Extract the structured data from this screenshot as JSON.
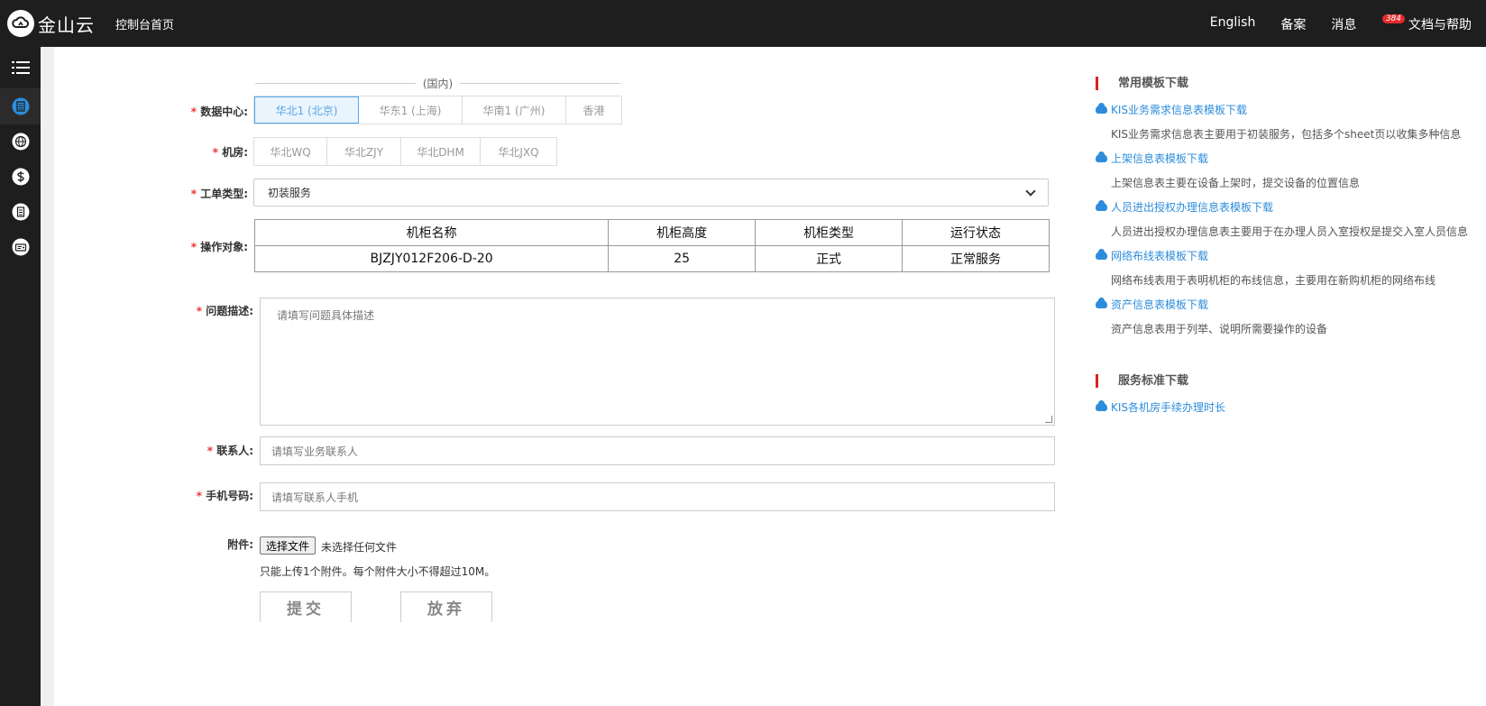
{
  "header": {
    "logo_text": "金山云",
    "console_home": "控制台首页",
    "nav": [
      {
        "label": "English"
      },
      {
        "label": "备案"
      },
      {
        "label": "消息",
        "badge": "384"
      },
      {
        "label": "文档与帮助"
      }
    ]
  },
  "sidebar": {
    "items": [
      "menu-icon",
      "server-list-icon",
      "globe-icon",
      "dollar-icon",
      "document-icon",
      "ticket-icon"
    ],
    "active_index": 1
  },
  "form": {
    "domestic_label": "(国内)",
    "datacenter": {
      "label": "数据中心:",
      "options": [
        "华北1 (北京)",
        "华东1 (上海)",
        "华南1 (广州)",
        "香港"
      ],
      "selected": 0
    },
    "room": {
      "label": "机房:",
      "options": [
        "华北WQ",
        "华北ZJY",
        "华北DHM",
        "华北JXQ"
      ]
    },
    "ticket_type": {
      "label": "工单类型:",
      "value": "初装服务"
    },
    "target": {
      "label": "操作对象:",
      "headers": [
        "机柜名称",
        "机柜高度",
        "机柜类型",
        "运行状态"
      ],
      "rows": [
        [
          "BJZJY012F206-D-20",
          "25",
          "正式",
          "正常服务"
        ]
      ]
    },
    "description": {
      "label": "问题描述:",
      "placeholder": "请填写问题具体描述"
    },
    "contact": {
      "label": "联系人:",
      "placeholder": "请填写业务联系人"
    },
    "phone": {
      "label": "手机号码:",
      "placeholder": "请填写联系人手机"
    },
    "attachment": {
      "label": "附件:",
      "button": "选择文件",
      "status": "未选择任何文件",
      "hint": "只能上传1个附件。每个附件大小不得超过10M。"
    },
    "submit": "提交",
    "cancel": "放弃"
  },
  "templates": {
    "title": "常用模板下载",
    "items": [
      {
        "link": "KIS业务需求信息表模板下载",
        "desc": "KIS业务需求信息表主要用于初装服务，包括多个sheet页以收集多种信息"
      },
      {
        "link": "上架信息表模板下载",
        "desc": "上架信息表主要在设备上架时，提交设备的位置信息"
      },
      {
        "link": "人员进出授权办理信息表模板下载",
        "desc": "人员进出授权办理信息表主要用于在办理人员入室授权是提交入室人员信息"
      },
      {
        "link": "网络布线表模板下载",
        "desc": "网络布线表用于表明机柜的布线信息，主要用在新购机柜的网络布线"
      },
      {
        "link": "资产信息表模板下载",
        "desc": "资产信息表用于列举、说明所需要操作的设备"
      }
    ]
  },
  "standards": {
    "title": "服务标准下载",
    "items": [
      {
        "link": "KIS各机房手续办理时长"
      }
    ]
  },
  "colors": {
    "accent": "#2d8cdb",
    "topbar": "#1e1e1e",
    "required": "#e33333",
    "title_bar": "#d9231c"
  }
}
